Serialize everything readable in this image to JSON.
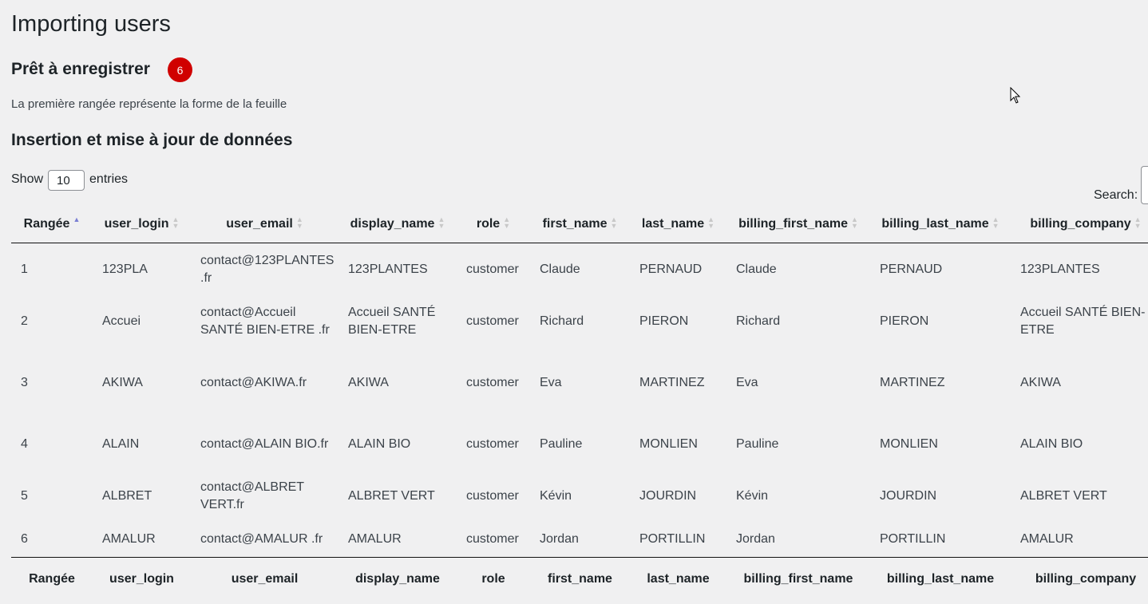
{
  "page": {
    "title": "Importing users",
    "ready_heading": "Prêt à enregistrer",
    "count_badge": "6",
    "intro": "La première rangée représente la forme de la feuille",
    "section_heading": "Insertion et mise à jour de données"
  },
  "controls": {
    "show_label": "Show",
    "page_length": "10",
    "entries_label": "entries",
    "search_label": "Search:"
  },
  "colors": {
    "badge": "#d00000",
    "sort_active": "#7a7fd4"
  },
  "table": {
    "columns": [
      "Rangée",
      "user_login",
      "user_email",
      "display_name",
      "role",
      "first_name",
      "last_name",
      "billing_first_name",
      "billing_last_name",
      "billing_company"
    ],
    "sorted_column": "Rangée",
    "sort_direction": "ascending",
    "rows": [
      [
        "1",
        "123PLA",
        "contact@123PLANTES .fr",
        "123PLANTES",
        "customer",
        "Claude",
        "PERNAUD",
        "Claude",
        "PERNAUD",
        "123PLANTES"
      ],
      [
        "2",
        "Accuei",
        "contact@Accueil SANTÉ BIEN-ETRE .fr",
        "Accueil SANTÉ BIEN-ETRE",
        "customer",
        "Richard",
        "PIERON",
        "Richard",
        "PIERON",
        "Accueil SANTÉ BIEN-ETRE"
      ],
      [
        "3",
        "AKIWA",
        "contact@AKIWA.fr",
        "AKIWA",
        "customer",
        "Eva",
        "MARTINEZ",
        "Eva",
        "MARTINEZ",
        "AKIWA"
      ],
      [
        "4",
        "ALAIN",
        "contact@ALAIN BIO.fr",
        "ALAIN BIO",
        "customer",
        "Pauline",
        "MONLIEN",
        "Pauline",
        "MONLIEN",
        "ALAIN BIO"
      ],
      [
        "5",
        "ALBRET",
        "contact@ALBRET VERT.fr",
        "ALBRET VERT",
        "customer",
        "Kévin",
        "JOURDIN",
        "Kévin",
        "JOURDIN",
        "ALBRET VERT"
      ],
      [
        "6",
        "AMALUR",
        "contact@AMALUR .fr",
        "AMALUR",
        "customer",
        "Jordan",
        "PORTILLIN",
        "Jordan",
        "PORTILLIN",
        "AMALUR"
      ]
    ]
  }
}
